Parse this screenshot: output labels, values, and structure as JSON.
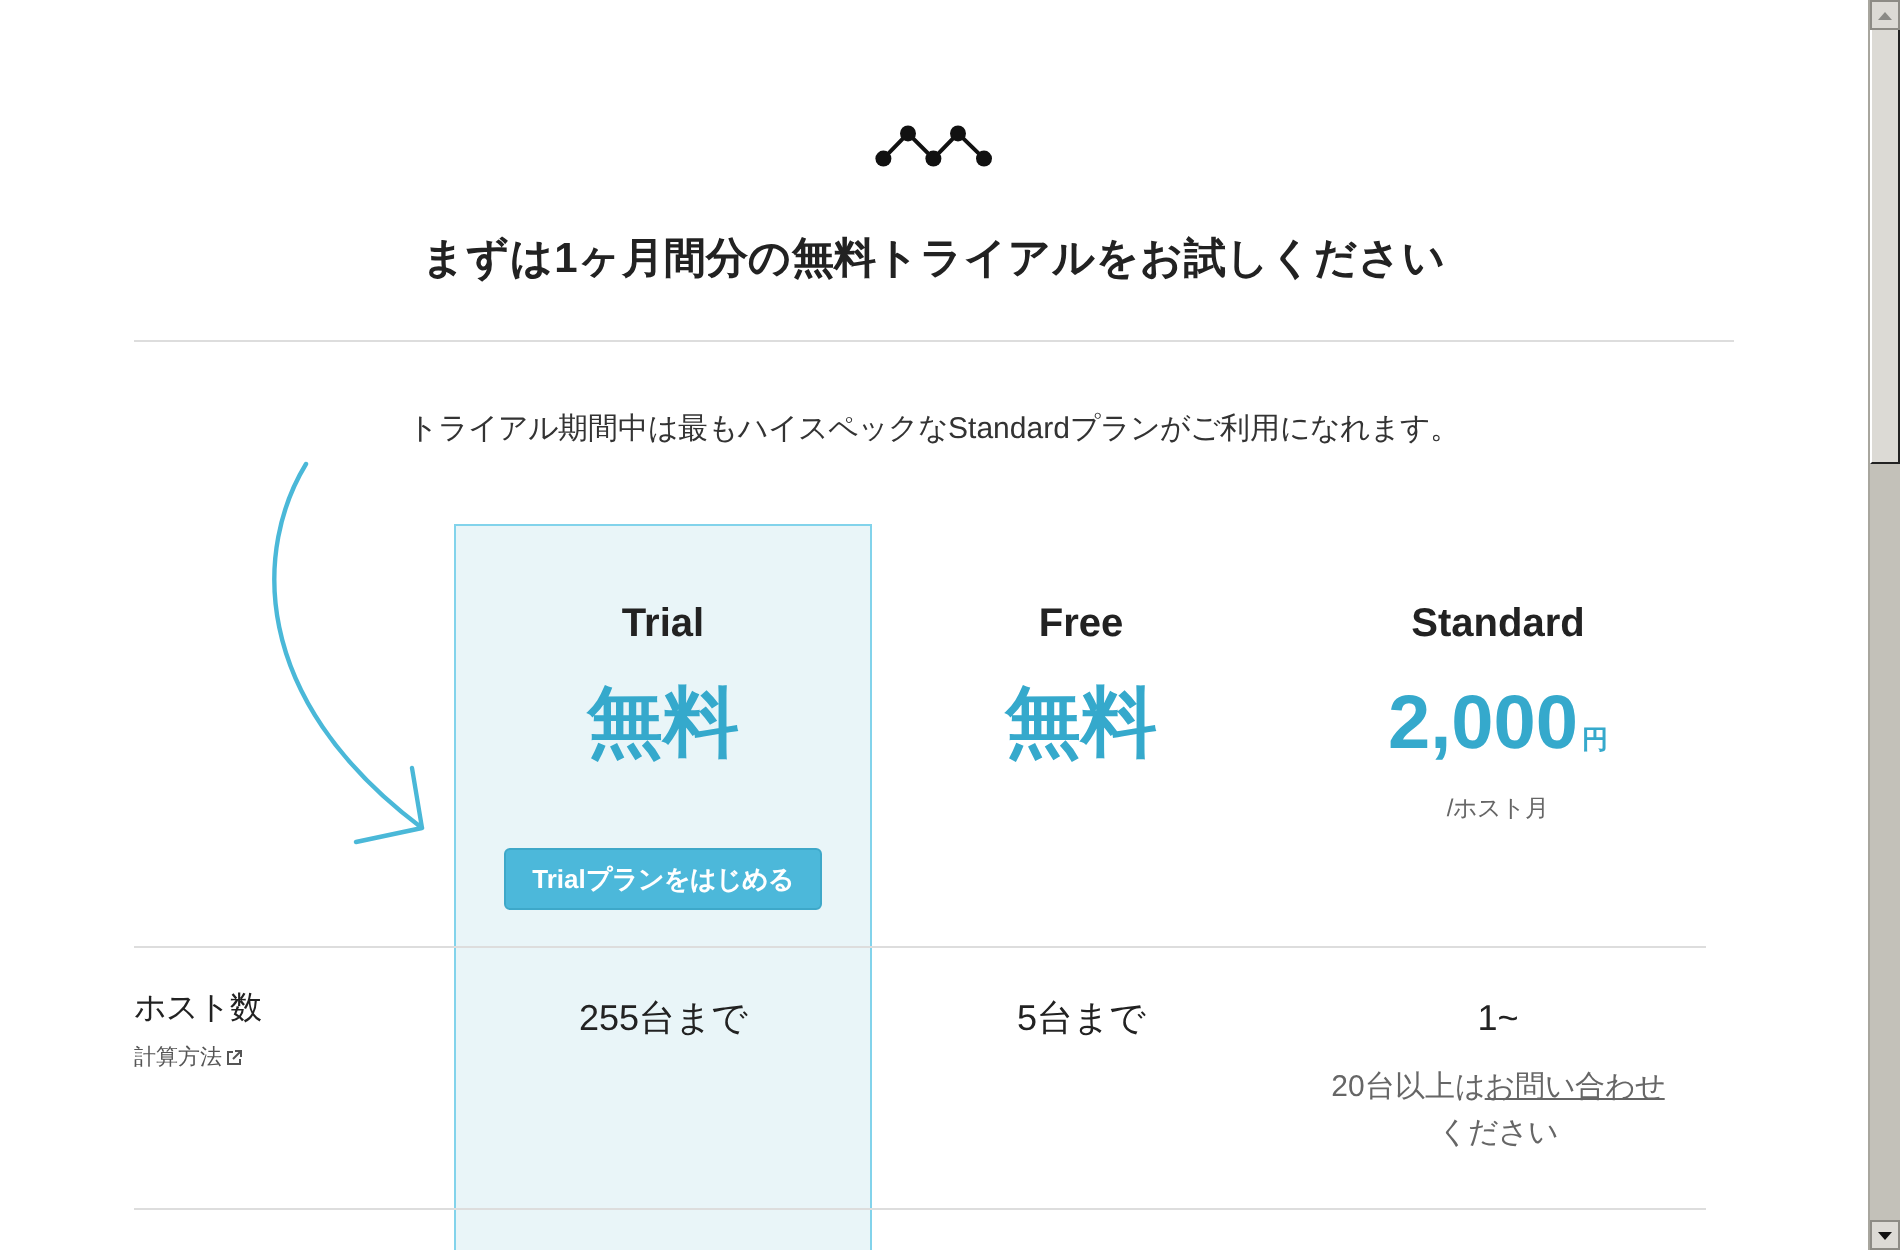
{
  "heading": "まずは1ヶ月間分の無料トライアルをお試しください",
  "intro": "トライアル期間中は最もハイスペックなStandardプランがご利用になれます。",
  "plans": [
    {
      "name": "Trial",
      "price": "無料",
      "highlighted": true,
      "button": "Trialプランをはじめる"
    },
    {
      "name": "Free",
      "price": "無料",
      "highlighted": false
    },
    {
      "name": "Standard",
      "price": "2,000",
      "currency": "円",
      "unit": "/ホスト月",
      "highlighted": false
    }
  ],
  "rows": [
    {
      "label": "ホスト数",
      "link": "計算方法",
      "values": [
        {
          "text": "255台まで"
        },
        {
          "text": "5台まで"
        },
        {
          "text": "1~",
          "note": {
            "before": "20台以上は",
            "link": "お問い合わせ",
            "after": "ください"
          }
        }
      ]
    }
  ]
}
